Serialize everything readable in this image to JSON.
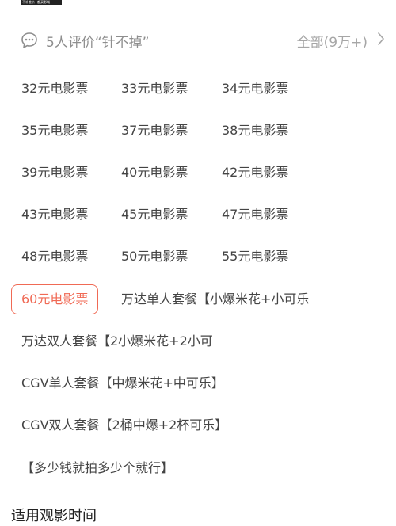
{
  "banner": {
    "left": "不补差价",
    "right": "都买影城"
  },
  "review": {
    "title": "5人评价“针不掉”",
    "all_label": "全部(9万+)"
  },
  "options": {
    "r1c1": "32元电影票",
    "r1c2": "33元电影票",
    "r1c3": "34元电影票",
    "r2c1": "35元电影票",
    "r2c2": "37元电影票",
    "r2c3": "38元电影票",
    "r3c1": "39元电影票",
    "r3c2": "40元电影票",
    "r3c3": "42元电影票",
    "r4c1": "43元电影票",
    "r4c2": "45元电影票",
    "r4c3": "47元电影票",
    "r5c1": "48元电影票",
    "r5c2": "50元电影票",
    "r5c3": "55元电影票",
    "selected": "60元电影票",
    "wanda_single": "万达单人套餐【小爆米花+小可乐",
    "wanda_double": "万达双人套餐【2小爆米花+2小可",
    "cgv_single": "CGV单人套餐【中爆米花+中可乐】",
    "cgv_double": "CGV双人套餐【2桶中爆+2杯可乐】",
    "any_amount": "【多少钱就拍多少个就行】"
  },
  "section": {
    "title": "适用观影时间"
  },
  "colors": {
    "selected_accent": "#f06a55",
    "muted_text": "#8e8e8e",
    "option_text": "#444444"
  }
}
